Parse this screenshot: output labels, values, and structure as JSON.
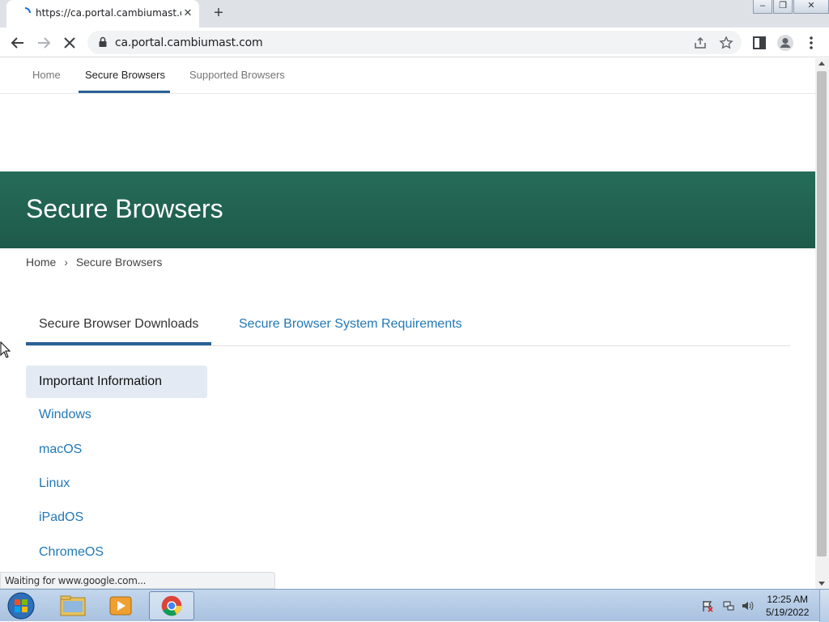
{
  "browser": {
    "tab_title": "https://ca.portal.cambiumast.com",
    "url": "ca.portal.cambiumast.com",
    "status_text": "Waiting for www.google.com..."
  },
  "topnav": {
    "items": [
      {
        "label": "Home"
      },
      {
        "label": "Secure Browsers"
      },
      {
        "label": "Supported Browsers"
      }
    ],
    "active": "Secure Browsers"
  },
  "hero": {
    "title": "Secure Browsers",
    "color": "#256c58"
  },
  "breadcrumb": {
    "home": "Home",
    "separator": "›",
    "current": "Secure Browsers"
  },
  "subtabs": {
    "items": [
      {
        "label": "Secure Browser Downloads"
      },
      {
        "label": "Secure Browser System Requirements"
      }
    ],
    "active": "Secure Browser Downloads"
  },
  "sidenav": {
    "items": [
      {
        "label": "Important Information"
      },
      {
        "label": "Windows"
      },
      {
        "label": "macOS"
      },
      {
        "label": "Linux"
      },
      {
        "label": "iPadOS"
      },
      {
        "label": "ChromeOS"
      }
    ],
    "active": "Important Information"
  },
  "taskbar": {
    "time": "12:25 AM",
    "date": "5/19/2022"
  },
  "colors": {
    "accent": "#2a6196",
    "link": "#2278b6"
  }
}
